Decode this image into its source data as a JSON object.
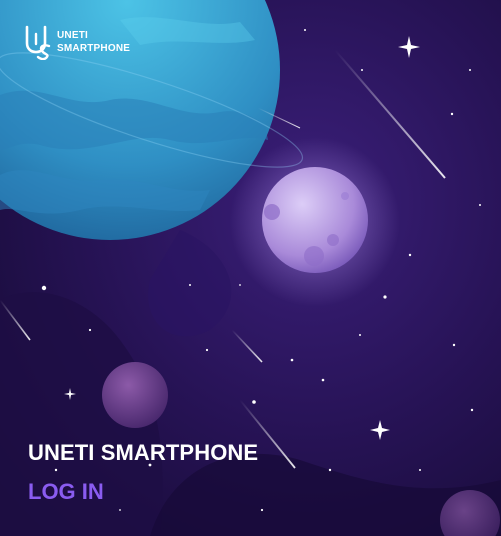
{
  "brand": {
    "line1": "UNETI",
    "line2": "SMARTPHONE"
  },
  "hero": {
    "title": "UNETI SMARTPHONE",
    "login_label": "LOG IN"
  },
  "colors": {
    "background": "#1a0f3a",
    "planet": "#3ea6d6",
    "moon": "#b9a0e8",
    "accent": "#8a5cf0",
    "text": "#ffffff"
  },
  "icons": [
    "uneti-logo-icon"
  ]
}
